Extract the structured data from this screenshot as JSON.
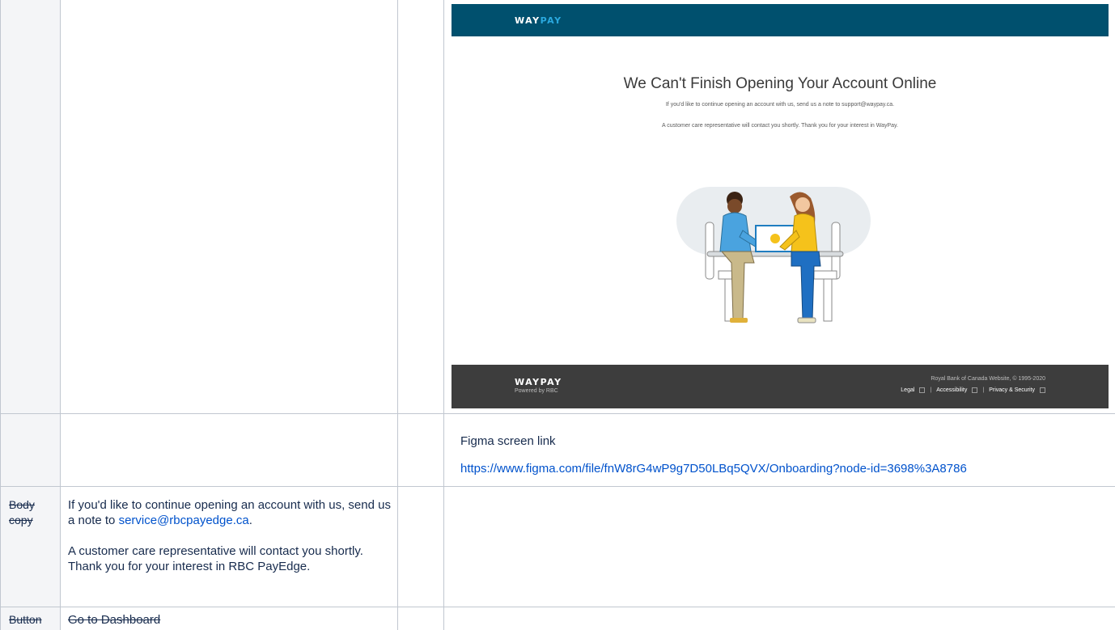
{
  "mockup": {
    "brand_way": "WAY",
    "brand_pay": "PAY",
    "title": "We Can't Finish Opening Your Account Online",
    "body_line_1": "If you'd like to continue opening an account with us, send us a note to support@waypay.ca.",
    "body_line_2": "A customer care representative will contact you shortly. Thank you for your interest in WayPay.",
    "footer_brand_way": "WAY",
    "footer_brand_pay": "PAY",
    "footer_powered": "Powered by RBC",
    "footer_copyright": "Royal Bank of Canada Website, © 1995-2020",
    "footer_links": [
      "Legal",
      "Accessibility",
      "Privacy & Security"
    ],
    "footer_separator": "|",
    "colors": {
      "header": "#00506e",
      "footer": "#3d3d3d",
      "accent": "#2aa9df"
    }
  },
  "figma": {
    "label": "Figma screen link",
    "url": "https://www.figma.com/file/fnW8rG4wP9g7D50LBq5QVX/Onboarding?node-id=3698%3A8786"
  },
  "rows": {
    "body_copy": {
      "label_line1": "Body",
      "label_line2": "copy",
      "para1_text": "If you'd like to continue opening an account with us, send us a note to",
      "para1_link": "service@rbcpayedge.ca",
      "para1_end": ".",
      "para2": "A customer care representative will contact you shortly. Thank you for your interest in RBC PayEdge."
    },
    "button": {
      "label": "Button",
      "value": "Go to Dashboard"
    }
  }
}
